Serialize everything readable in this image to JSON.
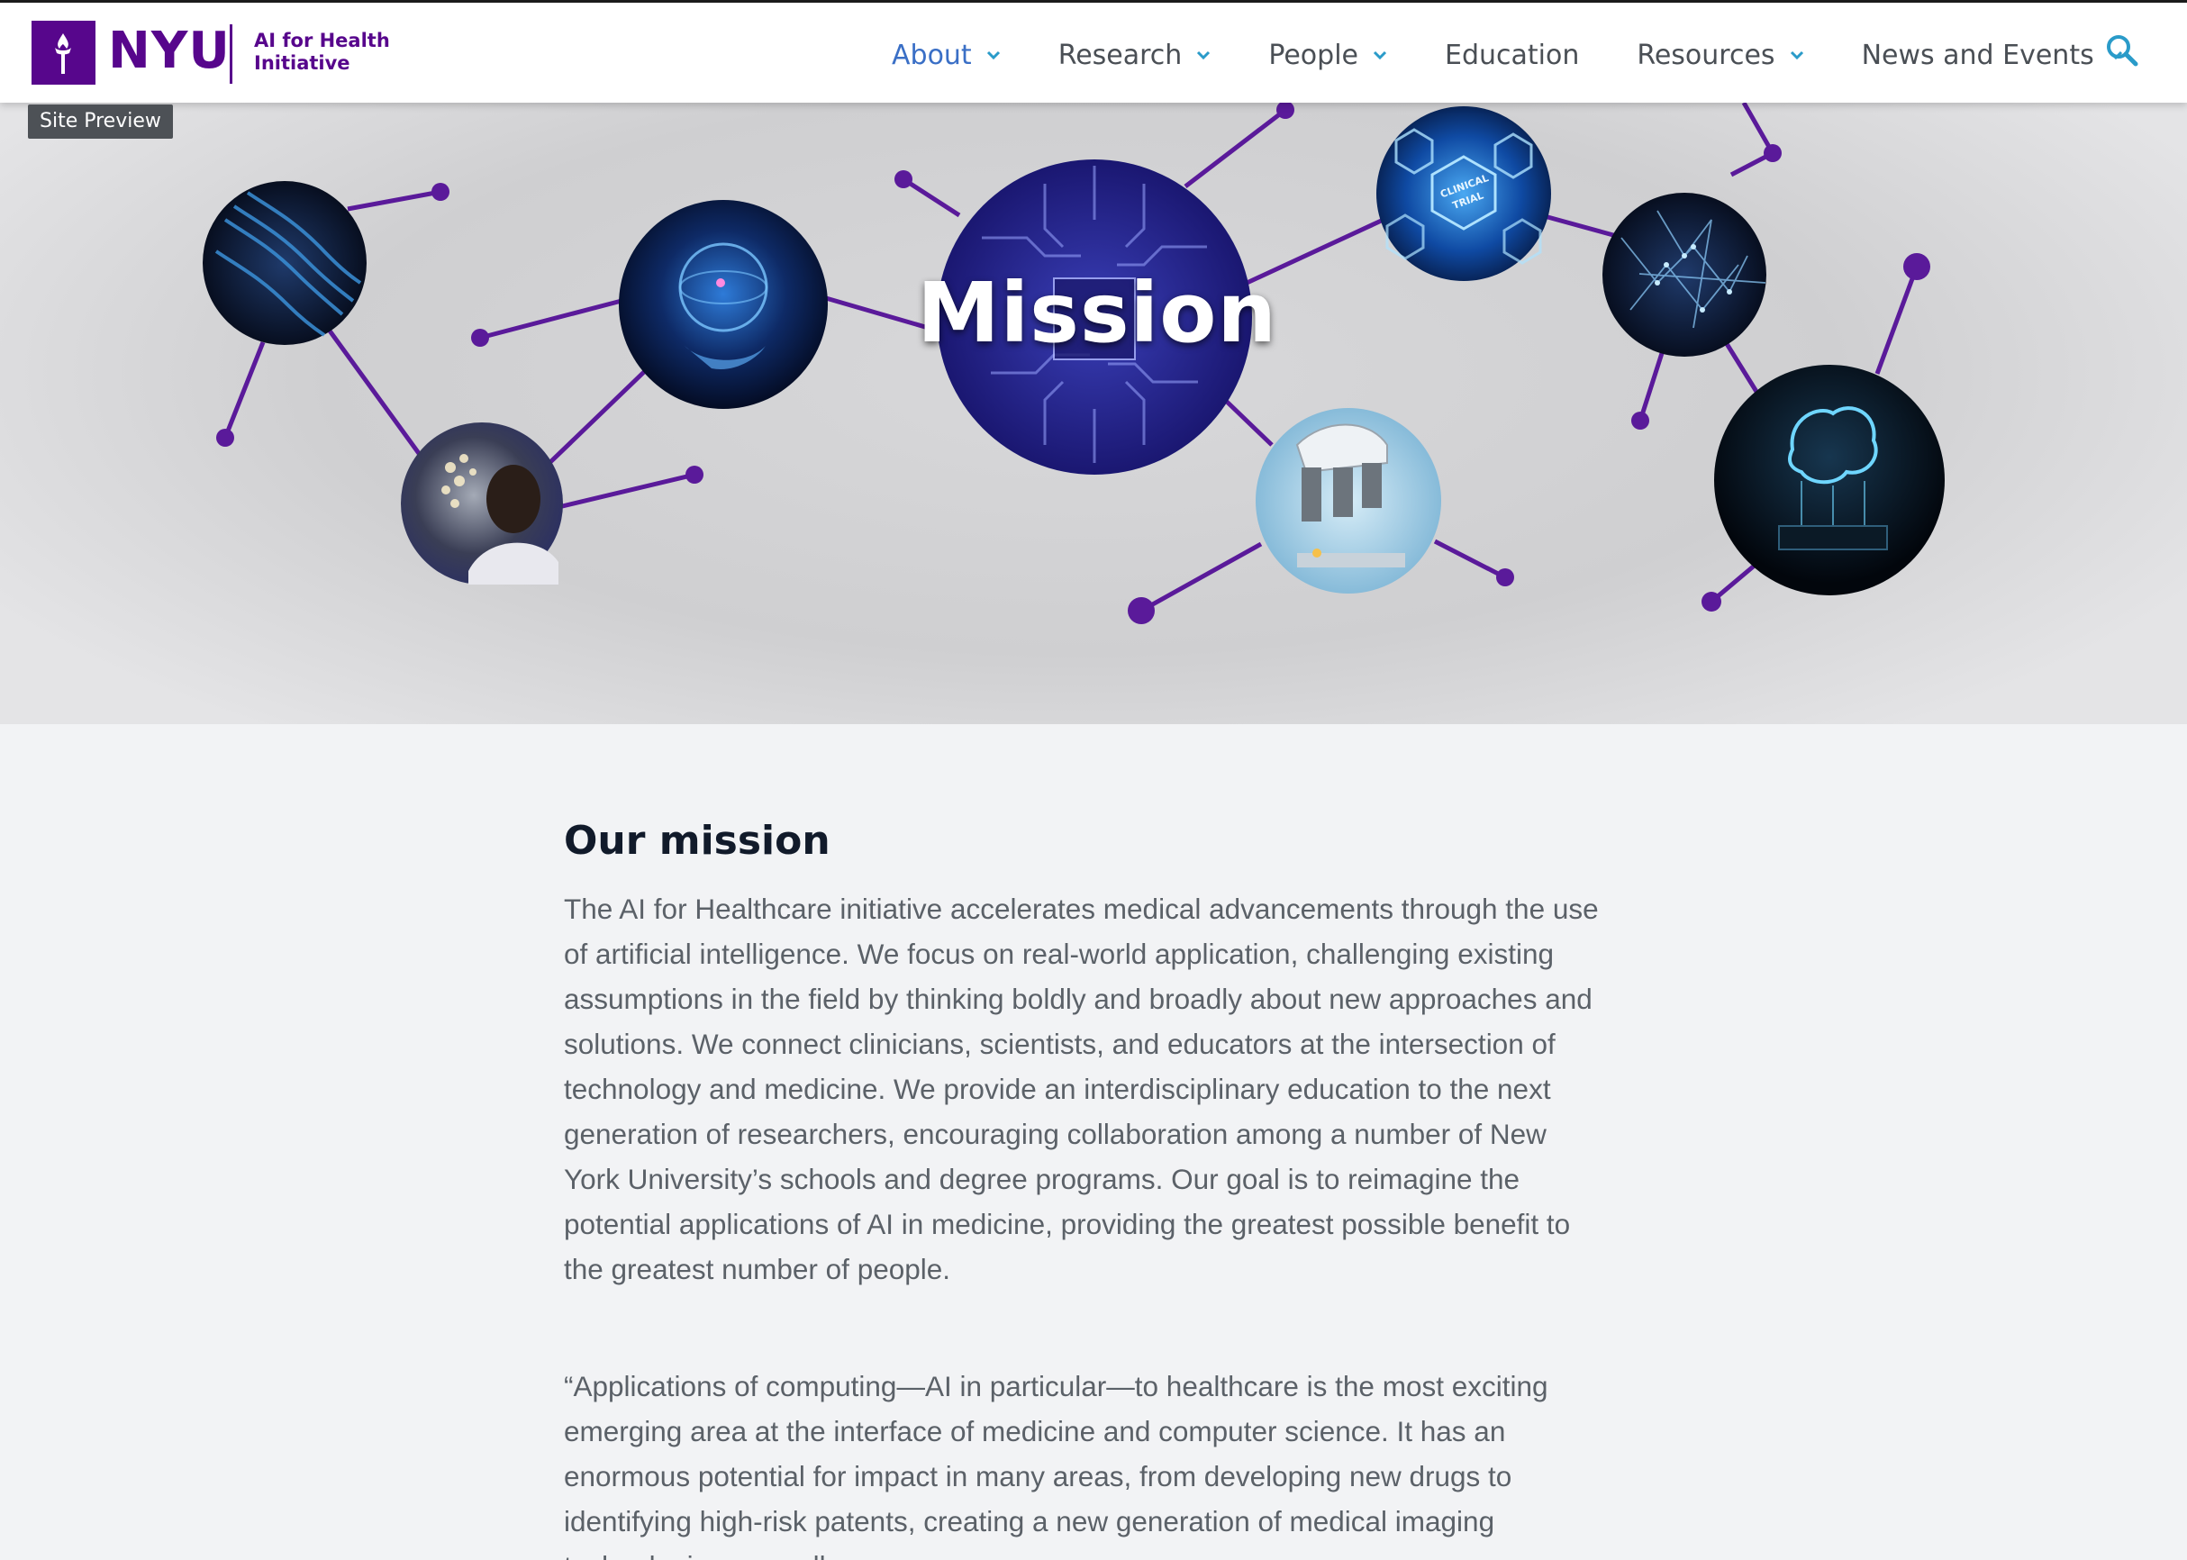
{
  "header": {
    "logo_text": "NYU",
    "logo_sub_line1": "AI for Health",
    "logo_sub_line2": "Initiative",
    "nav": [
      {
        "label": "About",
        "has_dropdown": true,
        "active": true
      },
      {
        "label": "Research",
        "has_dropdown": true,
        "active": false
      },
      {
        "label": "People",
        "has_dropdown": true,
        "active": false
      },
      {
        "label": "Education",
        "has_dropdown": false,
        "active": false
      },
      {
        "label": "Resources",
        "has_dropdown": true,
        "active": false
      },
      {
        "label": "News and Events",
        "has_dropdown": true,
        "active": false
      }
    ],
    "search_icon": "search-icon",
    "preview_tag": "Site Preview"
  },
  "hero": {
    "title": "Mission",
    "circle_labels": [
      "CLINICAL",
      "TRIAL"
    ]
  },
  "main": {
    "heading": "Our mission",
    "paragraph": "The AI for Healthcare initiative accelerates medical advancements through the use of artificial intelligence. We focus on real-world application, challenging existing assumptions in the field by thinking boldly and broadly about new approaches and solutions. We connect clinicians, scientists, and educators at the intersection of technology and medicine. We provide an interdisciplinary education to the next generation of researchers, encouraging collaboration among a number of New York University’s schools and degree programs. Our goal is to reimagine the potential applications of AI in medicine, providing the greatest possible benefit to the greatest number of people.",
    "quote": "“Applications of computing—AI in particular—to healthcare is the most exciting emerging area at the interface of medicine and computer science.  It has an enormous potential for impact in many areas, from developing new drugs to identifying high-risk patents, creating a new generation of medical imaging technologies, as well as"
  },
  "colors": {
    "brand": "#57068c",
    "nav_active": "#3a6fc6",
    "connector": "#5a1a9a",
    "text": "#5b6168",
    "heading": "#111a2a"
  }
}
